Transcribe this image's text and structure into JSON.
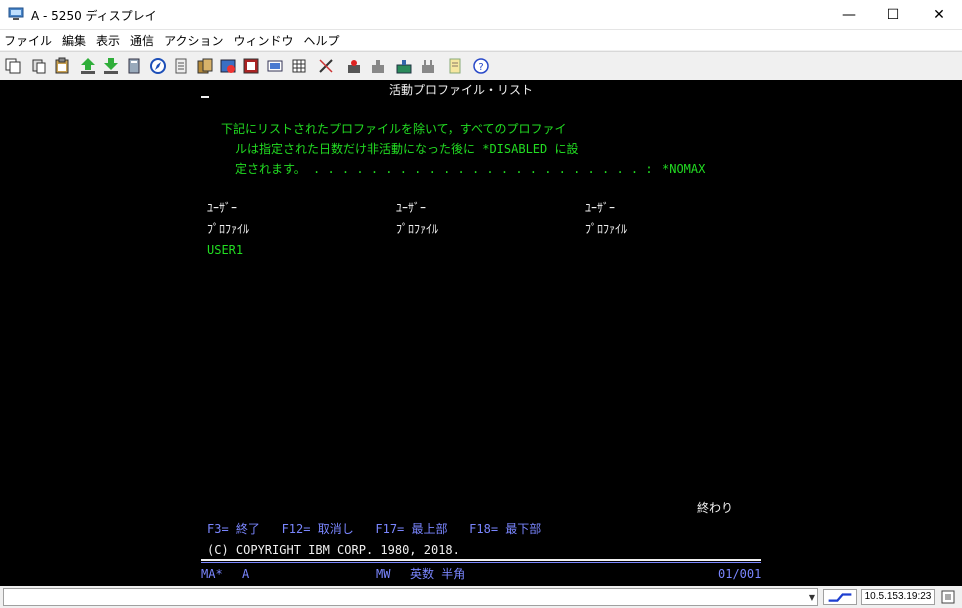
{
  "window": {
    "title": "A - 5250 ディスプレイ",
    "min_icon": "—",
    "max_icon": "☐",
    "close_icon": "✕"
  },
  "menu": [
    "ファイル",
    "編集",
    "表示",
    "通信",
    "アクション",
    "ウィンドウ",
    "ヘルプ"
  ],
  "toolbar_icons": [
    "copy-icon",
    "paste-icon",
    "clipboard-icon",
    "send-file-icon",
    "receive-file-icon",
    "print-screen-icon",
    "navigator-icon",
    "log-icon",
    "data-transfer-icon",
    "macro-icon",
    "record-icon",
    "keypad-icon",
    "calculator-icon",
    "edit-icon",
    "play-macro-icon",
    "stop-icon",
    "keyboard-icon",
    "settings-icon",
    "notes-icon",
    "help-icon"
  ],
  "terminal": {
    "screen_title": "活動プロファイル・リスト",
    "desc_line1": "下記にリストされたプロファイルを除いて，すべてのプロファイ",
    "desc_line2": "ルは指定された日数だけ非活動になった後に *DISABLED に設",
    "desc_line3": "定されます。 . . . . . . . . . . . . . . . . . . . . . . . :",
    "nomax_value": "*NOMAX",
    "col_header_line1": "ﾕｰｻﾞｰ",
    "col_header_line2": "ﾌﾟﾛﾌｧｲﾙ",
    "profiles": [
      "USER1"
    ],
    "end_label": "終わり",
    "function_keys": "F3= 終了   F12= 取消し   F17= 最上部   F18= 最下部",
    "copyright": "(C) COPYRIGHT IBM CORP. 1980, 2018.",
    "oia": {
      "ma": "MA*",
      "session": "A",
      "mw": "MW",
      "input_mode": "英数 半角",
      "cursor_pos": "01/001"
    }
  },
  "status": {
    "message": "",
    "ip_time": "10.5.153.19:23"
  },
  "colors": {
    "terminal_bg": "#000000",
    "green": "#22dd22",
    "white": "#f0f0f0",
    "blue": "#7a86ff"
  }
}
